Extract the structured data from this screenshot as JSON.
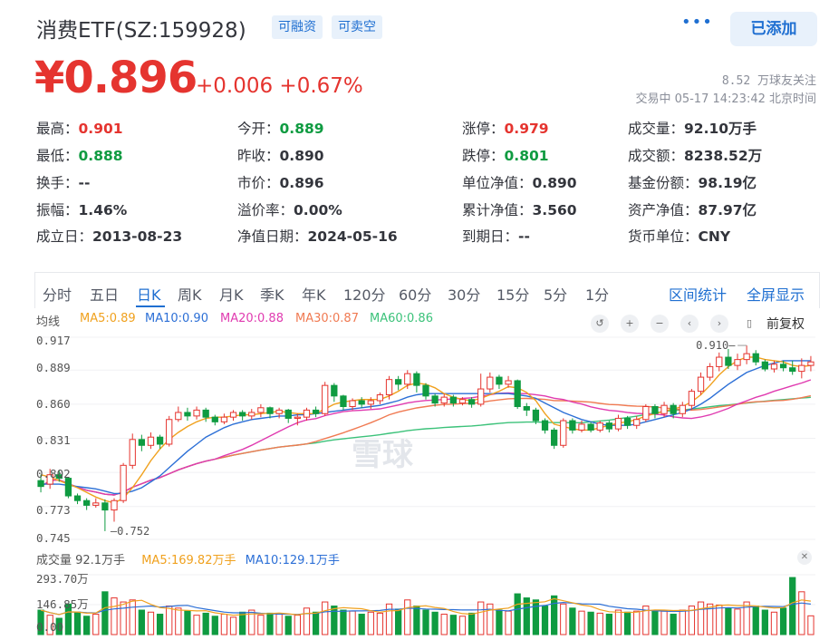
{
  "header": {
    "title": "消费ETF(SZ:159928)",
    "tag1": "可融资",
    "tag2": "可卖空",
    "more_icon": "more-icon",
    "add_label": "已添加"
  },
  "quote": {
    "price": "¥0.896",
    "change": "+0.006 +0.67%",
    "followers": "8.52 万球友关注",
    "time": "交易中 05-17 14:23:42 北京时间"
  },
  "stats": [
    {
      "label": "最高：",
      "value": "0.901",
      "color": "red"
    },
    {
      "label": "今开：",
      "value": "0.889",
      "color": "grn"
    },
    {
      "label": "涨停：",
      "value": "0.979",
      "color": "red"
    },
    {
      "label": "成交量：",
      "value": "92.10万手",
      "color": ""
    },
    {
      "label": "最低：",
      "value": "0.888",
      "color": "grn"
    },
    {
      "label": "昨收：",
      "value": "0.890",
      "color": ""
    },
    {
      "label": "跌停：",
      "value": "0.801",
      "color": "grn"
    },
    {
      "label": "成交额：",
      "value": "8238.52万",
      "color": ""
    },
    {
      "label": "换手：",
      "value": "--",
      "color": ""
    },
    {
      "label": "市价：",
      "value": "0.896",
      "color": ""
    },
    {
      "label": "单位净值：",
      "value": "0.890",
      "color": ""
    },
    {
      "label": "基金份额：",
      "value": "98.19亿",
      "color": ""
    },
    {
      "label": "振幅：",
      "value": "1.46%",
      "color": ""
    },
    {
      "label": "溢价率：",
      "value": "0.00%",
      "color": ""
    },
    {
      "label": "累计净值：",
      "value": "3.560",
      "color": ""
    },
    {
      "label": "资产净值：",
      "value": "87.97亿",
      "color": ""
    },
    {
      "label": "成立日：",
      "value": "2013-08-23",
      "color": ""
    },
    {
      "label": "净值日期：",
      "value": "2024-05-16",
      "color": ""
    },
    {
      "label": "到期日：",
      "value": "--",
      "color": ""
    },
    {
      "label": "货币单位：",
      "value": "CNY",
      "color": ""
    }
  ],
  "tabs": [
    "分时",
    "五日",
    "日K",
    "周K",
    "月K",
    "季K",
    "年K",
    "120分",
    "60分",
    "30分",
    "15分",
    "5分",
    "1分"
  ],
  "active_tab": "日K",
  "tab_right": [
    "区间统计",
    "全屏显示"
  ],
  "ma_line": {
    "label": "均线",
    "items": [
      {
        "text": "MA5:0.89",
        "color": "#f0a11e"
      },
      {
        "text": "MA10:0.90",
        "color": "#2c6fd6"
      },
      {
        "text": "MA20:0.88",
        "color": "#e03bb0"
      },
      {
        "text": "MA30:0.87",
        "color": "#f07a52"
      },
      {
        "text": "MA60:0.86",
        "color": "#3cc27a"
      }
    ]
  },
  "controls": [
    "undo-icon",
    "zoom-in-icon",
    "zoom-out-icon",
    "prev-icon",
    "next-icon",
    "candle-icon"
  ],
  "adjust_label": "前复权",
  "watermark": "雪球",
  "chart_data": {
    "type": "candlestick",
    "y_ticks": [
      "0.917",
      "0.889",
      "0.860",
      "0.831",
      "0.802",
      "0.773",
      "0.745"
    ],
    "ylim": [
      0.745,
      0.917
    ],
    "high_label": "0.910",
    "low_label": "0.752",
    "colors": {
      "up": "#e5342f",
      "down": "#0f9b41"
    },
    "candles": [
      [
        0.795,
        0.79,
        0.8,
        0.785
      ],
      [
        0.792,
        0.8,
        0.805,
        0.788
      ],
      [
        0.8,
        0.797,
        0.804,
        0.794
      ],
      [
        0.797,
        0.782,
        0.798,
        0.78
      ],
      [
        0.782,
        0.778,
        0.784,
        0.775
      ],
      [
        0.778,
        0.774,
        0.78,
        0.77
      ],
      [
        0.774,
        0.776,
        0.78,
        0.772
      ],
      [
        0.776,
        0.77,
        0.779,
        0.752
      ],
      [
        0.77,
        0.778,
        0.78,
        0.76
      ],
      [
        0.778,
        0.808,
        0.81,
        0.776
      ],
      [
        0.808,
        0.83,
        0.835,
        0.805
      ],
      [
        0.83,
        0.825,
        0.834,
        0.82
      ],
      [
        0.825,
        0.832,
        0.836,
        0.822
      ],
      [
        0.832,
        0.826,
        0.834,
        0.822
      ],
      [
        0.826,
        0.847,
        0.85,
        0.824
      ],
      [
        0.847,
        0.853,
        0.858,
        0.845
      ],
      [
        0.853,
        0.85,
        0.857,
        0.846
      ],
      [
        0.85,
        0.855,
        0.858,
        0.847
      ],
      [
        0.855,
        0.849,
        0.857,
        0.845
      ],
      [
        0.849,
        0.845,
        0.851,
        0.842
      ],
      [
        0.845,
        0.849,
        0.852,
        0.843
      ],
      [
        0.849,
        0.853,
        0.855,
        0.846
      ],
      [
        0.853,
        0.85,
        0.855,
        0.846
      ],
      [
        0.85,
        0.853,
        0.856,
        0.847
      ],
      [
        0.853,
        0.857,
        0.86,
        0.849
      ],
      [
        0.857,
        0.852,
        0.858,
        0.848
      ],
      [
        0.852,
        0.855,
        0.857,
        0.848
      ],
      [
        0.855,
        0.848,
        0.856,
        0.844
      ],
      [
        0.848,
        0.849,
        0.852,
        0.842
      ],
      [
        0.849,
        0.855,
        0.857,
        0.846
      ],
      [
        0.855,
        0.852,
        0.858,
        0.849
      ],
      [
        0.852,
        0.876,
        0.879,
        0.85
      ],
      [
        0.876,
        0.867,
        0.878,
        0.862
      ],
      [
        0.867,
        0.858,
        0.868,
        0.855
      ],
      [
        0.858,
        0.863,
        0.865,
        0.855
      ],
      [
        0.863,
        0.86,
        0.866,
        0.857
      ],
      [
        0.86,
        0.863,
        0.866,
        0.856
      ],
      [
        0.863,
        0.868,
        0.87,
        0.86
      ],
      [
        0.868,
        0.881,
        0.884,
        0.864
      ],
      [
        0.881,
        0.877,
        0.884,
        0.872
      ],
      [
        0.877,
        0.886,
        0.889,
        0.873
      ],
      [
        0.886,
        0.876,
        0.888,
        0.87
      ],
      [
        0.876,
        0.867,
        0.878,
        0.864
      ],
      [
        0.867,
        0.861,
        0.869,
        0.858
      ],
      [
        0.861,
        0.866,
        0.869,
        0.858
      ],
      [
        0.866,
        0.861,
        0.868,
        0.858
      ],
      [
        0.861,
        0.864,
        0.866,
        0.859
      ],
      [
        0.864,
        0.86,
        0.866,
        0.857
      ],
      [
        0.86,
        0.873,
        0.886,
        0.858
      ],
      [
        0.873,
        0.883,
        0.887,
        0.87
      ],
      [
        0.883,
        0.877,
        0.885,
        0.873
      ],
      [
        0.877,
        0.88,
        0.884,
        0.874
      ],
      [
        0.88,
        0.858,
        0.881,
        0.856
      ],
      [
        0.858,
        0.855,
        0.861,
        0.85
      ],
      [
        0.855,
        0.846,
        0.857,
        0.843
      ],
      [
        0.846,
        0.838,
        0.848,
        0.835
      ],
      [
        0.838,
        0.825,
        0.84,
        0.822
      ],
      [
        0.825,
        0.846,
        0.848,
        0.823
      ],
      [
        0.846,
        0.838,
        0.848,
        0.835
      ],
      [
        0.838,
        0.843,
        0.846,
        0.836
      ],
      [
        0.843,
        0.838,
        0.845,
        0.836
      ],
      [
        0.838,
        0.844,
        0.846,
        0.836
      ],
      [
        0.844,
        0.839,
        0.846,
        0.836
      ],
      [
        0.839,
        0.848,
        0.851,
        0.837
      ],
      [
        0.848,
        0.842,
        0.85,
        0.839
      ],
      [
        0.842,
        0.847,
        0.85,
        0.839
      ],
      [
        0.847,
        0.858,
        0.86,
        0.845
      ],
      [
        0.858,
        0.852,
        0.86,
        0.848
      ],
      [
        0.852,
        0.859,
        0.862,
        0.849
      ],
      [
        0.859,
        0.852,
        0.861,
        0.848
      ],
      [
        0.852,
        0.859,
        0.862,
        0.849
      ],
      [
        0.859,
        0.871,
        0.873,
        0.855
      ],
      [
        0.871,
        0.883,
        0.887,
        0.868
      ],
      [
        0.883,
        0.892,
        0.895,
        0.88
      ],
      [
        0.892,
        0.9,
        0.904,
        0.888
      ],
      [
        0.9,
        0.893,
        0.907,
        0.89
      ],
      [
        0.893,
        0.898,
        0.903,
        0.889
      ],
      [
        0.898,
        0.903,
        0.91,
        0.894
      ],
      [
        0.903,
        0.896,
        0.906,
        0.893
      ],
      [
        0.896,
        0.89,
        0.898,
        0.888
      ],
      [
        0.89,
        0.894,
        0.897,
        0.887
      ],
      [
        0.894,
        0.891,
        0.897,
        0.888
      ],
      [
        0.891,
        0.888,
        0.897,
        0.885
      ],
      [
        0.888,
        0.893,
        0.899,
        0.882
      ],
      [
        0.893,
        0.896,
        0.901,
        0.888
      ]
    ],
    "ma": {
      "MA5": [
        0.8,
        0.798,
        0.795,
        0.792,
        0.789,
        0.785,
        0.781,
        0.778,
        0.776,
        0.78,
        0.789,
        0.8,
        0.812,
        0.822,
        0.83,
        0.836,
        0.841,
        0.845,
        0.848,
        0.849,
        0.849,
        0.85,
        0.851,
        0.851,
        0.852,
        0.853,
        0.854,
        0.853,
        0.852,
        0.852,
        0.852,
        0.856,
        0.86,
        0.862,
        0.863,
        0.864,
        0.864,
        0.864,
        0.867,
        0.871,
        0.876,
        0.878,
        0.877,
        0.874,
        0.869,
        0.866,
        0.864,
        0.863,
        0.865,
        0.868,
        0.871,
        0.875,
        0.874,
        0.87,
        0.863,
        0.852,
        0.843,
        0.841,
        0.839,
        0.838,
        0.838,
        0.84,
        0.842,
        0.844,
        0.845,
        0.847,
        0.85,
        0.852,
        0.854,
        0.856,
        0.858,
        0.862,
        0.868,
        0.876,
        0.885,
        0.892,
        0.897,
        0.9,
        0.9,
        0.898,
        0.897,
        0.896,
        0.893,
        0.892,
        0.893
      ],
      "MA10": [
        0.792,
        0.792,
        0.792,
        0.791,
        0.79,
        0.789,
        0.788,
        0.786,
        0.784,
        0.784,
        0.786,
        0.789,
        0.794,
        0.799,
        0.806,
        0.813,
        0.82,
        0.826,
        0.832,
        0.836,
        0.84,
        0.843,
        0.845,
        0.847,
        0.848,
        0.849,
        0.85,
        0.85,
        0.851,
        0.851,
        0.852,
        0.853,
        0.854,
        0.855,
        0.856,
        0.857,
        0.858,
        0.859,
        0.861,
        0.863,
        0.866,
        0.868,
        0.869,
        0.869,
        0.869,
        0.869,
        0.869,
        0.869,
        0.869,
        0.869,
        0.869,
        0.869,
        0.868,
        0.867,
        0.865,
        0.861,
        0.857,
        0.853,
        0.85,
        0.847,
        0.845,
        0.843,
        0.842,
        0.842,
        0.842,
        0.843,
        0.845,
        0.847,
        0.849,
        0.851,
        0.853,
        0.856,
        0.86,
        0.865,
        0.871,
        0.877,
        0.882,
        0.887,
        0.89,
        0.893,
        0.895,
        0.897,
        0.897,
        0.897,
        0.897
      ]
    }
  },
  "volume": {
    "label": "成交量 92.1万手",
    "ma5": {
      "text": "MA5:169.82万手",
      "color": "#f0a11e"
    },
    "ma10": {
      "text": "MA10:129.1万手",
      "color": "#2c6fd6"
    },
    "y_ticks": [
      "293.70万",
      "146.85万",
      "0.00"
    ],
    "ylim": [
      0,
      293.7
    ],
    "values": [
      120,
      95,
      80,
      150,
      110,
      90,
      100,
      210,
      180,
      160,
      170,
      120,
      110,
      100,
      140,
      130,
      115,
      95,
      105,
      90,
      100,
      85,
      110,
      120,
      95,
      105,
      100,
      90,
      95,
      130,
      110,
      160,
      140,
      120,
      115,
      100,
      110,
      105,
      150,
      125,
      170,
      140,
      120,
      110,
      100,
      95,
      90,
      105,
      160,
      150,
      120,
      115,
      200,
      180,
      170,
      140,
      190,
      150,
      130,
      115,
      110,
      105,
      100,
      120,
      110,
      115,
      140,
      120,
      115,
      100,
      120,
      140,
      160,
      150,
      145,
      130,
      125,
      160,
      140,
      120,
      110,
      130,
      280,
      210,
      92
    ]
  }
}
